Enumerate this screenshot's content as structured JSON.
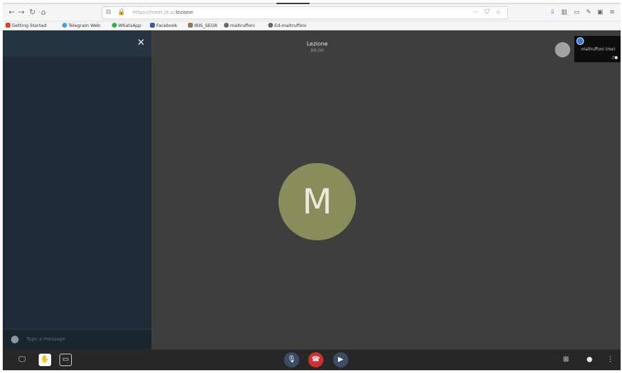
{
  "browser": {
    "url_host": "https://meet.jit.si/",
    "url_path": "lezione",
    "bookmarks": [
      {
        "label": "Getting Started",
        "color": "#d8412f"
      },
      {
        "label": "Telegram Web",
        "color": "#2ea6df"
      },
      {
        "label": "WhatsApp",
        "color": "#25b34a"
      },
      {
        "label": "Facebook",
        "color": "#3b5998"
      },
      {
        "label": "IRIS_SEGR",
        "color": "#8a7d5b"
      },
      {
        "label": "maltruffoni",
        "color": "#666666"
      },
      {
        "label": "Ed-maltruffoni",
        "color": "#666666"
      }
    ]
  },
  "meeting": {
    "title": "Lezione",
    "time": "00:00",
    "main_avatar_letter": "M",
    "main_avatar_color": "#8a8c5c",
    "thumbnail_name": "maltruffoni (me)"
  },
  "chat": {
    "placeholder": "Type a message"
  },
  "colors": {
    "chat_panel": "#1e2a36",
    "stage": "#3e3e3e",
    "hangup": "#d12f2f",
    "control": "#3b4d66"
  },
  "icons": {
    "close": "close-icon",
    "screenshare": "screen-share-icon",
    "raise_hand": "raise-hand-icon",
    "chat": "chat-icon",
    "mic": "microphone-muted-icon",
    "hangup": "hangup-icon",
    "camera": "camera-muted-icon",
    "tile": "tile-view-icon",
    "info": "info-icon",
    "more": "more-icon"
  }
}
